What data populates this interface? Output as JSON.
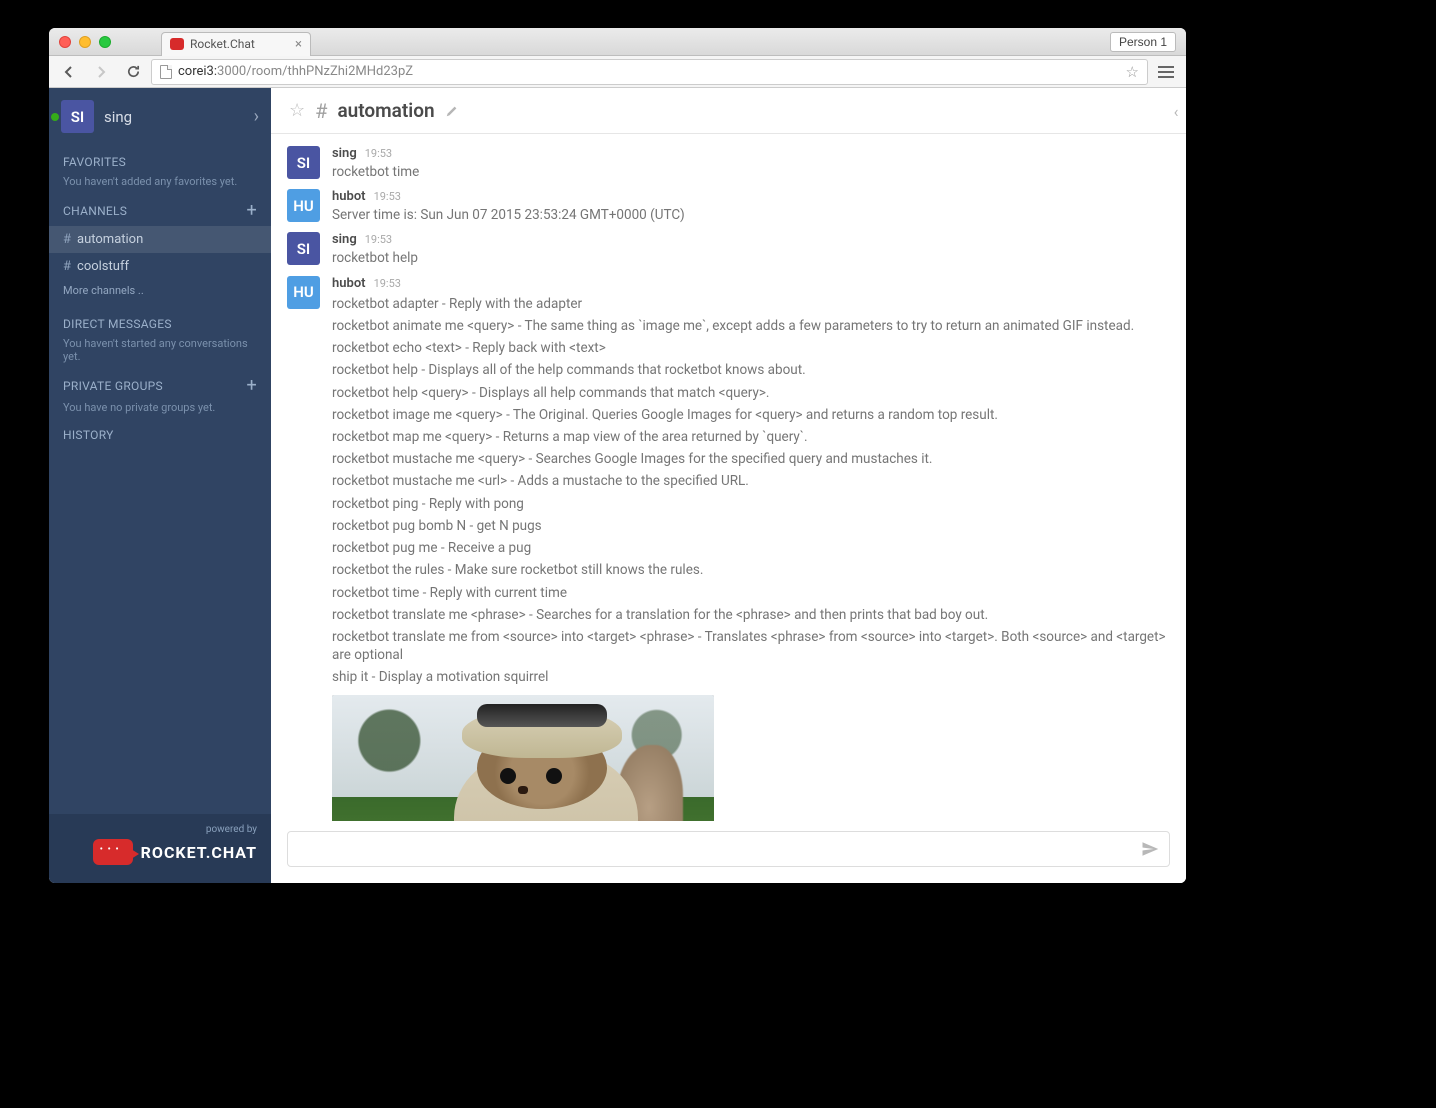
{
  "browser": {
    "tab_title": "Rocket.Chat",
    "profile_label": "Person 1",
    "url_host": "corei3:",
    "url_path": "3000/room/thhPNzZhi2MHd23pZ"
  },
  "sidebar": {
    "user_initials": "SI",
    "username": "sing",
    "favorites_heading": "FAVORITES",
    "favorites_empty": "You haven't added any favorites yet.",
    "channels_heading": "CHANNELS",
    "channels": [
      {
        "name": "automation",
        "active": true
      },
      {
        "name": "coolstuff",
        "active": false
      }
    ],
    "more_channels": "More channels ..",
    "dm_heading": "DIRECT MESSAGES",
    "dm_empty": "You haven't started any conversations yet.",
    "pg_heading": "PRIVATE GROUPS",
    "pg_empty": "You have no private groups yet.",
    "history_heading": "HISTORY",
    "powered_by": "powered by",
    "brand": "ROCKET.CHAT"
  },
  "header": {
    "channel_name": "automation"
  },
  "messages": [
    {
      "user": "sing",
      "initials": "SI",
      "av": "av-si",
      "time": "19:53",
      "text": "rocketbot time"
    },
    {
      "user": "hubot",
      "initials": "HU",
      "av": "av-hu",
      "time": "19:53",
      "text": "Server time is: Sun Jun 07 2015 23:53:24 GMT+0000 (UTC)"
    },
    {
      "user": "sing",
      "initials": "SI",
      "av": "av-si",
      "time": "19:53",
      "text": "rocketbot help"
    },
    {
      "user": "hubot",
      "initials": "HU",
      "av": "av-hu",
      "time": "19:53",
      "lines": [
        "rocketbot adapter - Reply with the adapter",
        "rocketbot animate me <query> - The same thing as `image me`, except adds a few parameters to try to return an animated GIF instead.",
        "rocketbot echo <text> - Reply back with <text>",
        "rocketbot help - Displays all of the help commands that rocketbot knows about.",
        "rocketbot help <query> - Displays all help commands that match <query>.",
        "rocketbot image me <query> - The Original. Queries Google Images for <query> and returns a random top result.",
        "rocketbot map me <query> - Returns a map view of the area returned by `query`.",
        "rocketbot mustache me <query> - Searches Google Images for the specified query and mustaches it.",
        "rocketbot mustache me <url> - Adds a mustache to the specified URL.",
        "rocketbot ping - Reply with pong",
        "rocketbot pug bomb N - get N pugs",
        "rocketbot pug me - Receive a pug",
        "rocketbot the rules - Make sure rocketbot still knows the rules.",
        "rocketbot time - Reply with current time",
        "rocketbot translate me <phrase> - Searches for a translation for the <phrase> and then prints that bad boy out.",
        "rocketbot translate me from <source> into <target> <phrase> - Translates <phrase> from <source> into <target>. Both <source> and <target> are optional",
        "ship it - Display a motivation squirrel"
      ],
      "has_image": true
    }
  ],
  "composer": {
    "placeholder": ""
  }
}
